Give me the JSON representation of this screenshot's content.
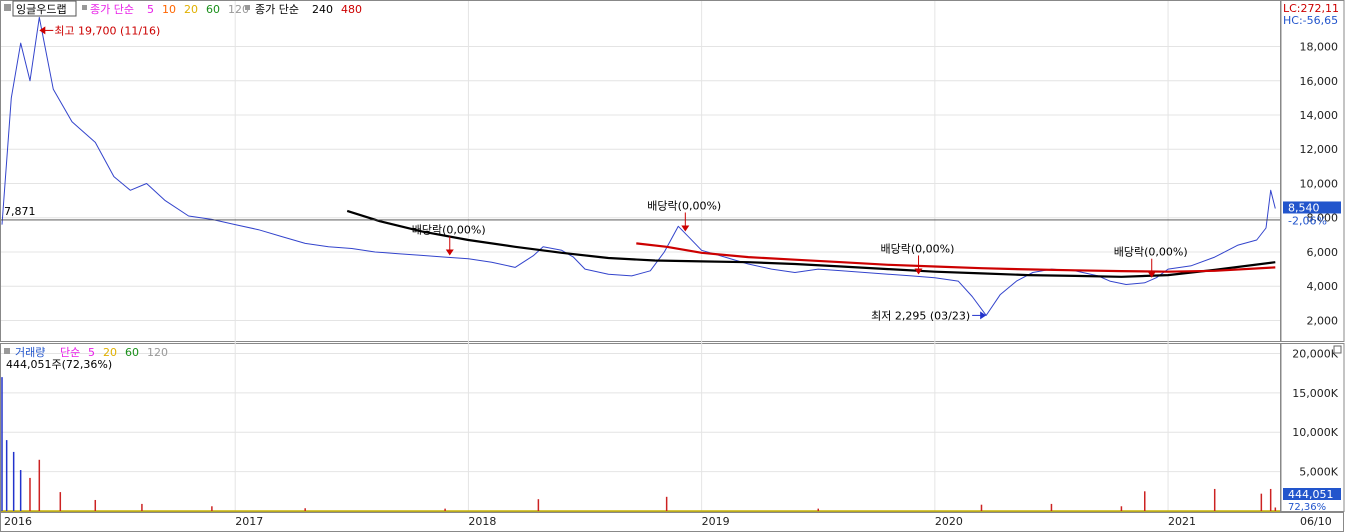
{
  "price_legend": {
    "title": "잉글우드랩",
    "ma_label": "종가 단순",
    "ma_periods": [
      "5",
      "10",
      "20",
      "60",
      "120"
    ],
    "ma_colors": [
      "#e81ee8",
      "#ff6600",
      "#e0b000",
      "#1a8f1a",
      "#999999"
    ],
    "ma2_label": "종가 단순",
    "ma2_periods": [
      "240",
      "480"
    ],
    "ma2_colors": [
      "#000000",
      "#cc0000"
    ]
  },
  "volume_legend": {
    "title": "거래량",
    "ma_label": "단순",
    "ma_periods": [
      "5",
      "20",
      "60",
      "120"
    ],
    "ma_colors": [
      "#e81ee8",
      "#e0b000",
      "#1a8f1a",
      "#999999"
    ],
    "current_value": "444,051주(72,36%)"
  },
  "info": {
    "lc": "LC:272,11",
    "hc": "HC:-56,65"
  },
  "labels": {
    "high": "최고 19,700 (11/16)",
    "low": "최저 2,295 (03/23)",
    "left_price": "7,871",
    "current_price": "8,540",
    "current_change": "-2,06%",
    "current_volume": "444,051",
    "current_volume_pct": "72,36%"
  },
  "annotations": [
    {
      "text": "배당락(0,00%)",
      "year": 2017.92
    },
    {
      "text": "배당락(0,00%)",
      "year": 2018.93
    },
    {
      "text": "배당락(0,00%)",
      "year": 2019.93
    },
    {
      "text": "배당락(0,00%)",
      "year": 2020.93
    }
  ],
  "chart_data": {
    "type": "line",
    "x_tick_labels": [
      "2016",
      "2017",
      "2018",
      "2019",
      "2020",
      "2021",
      "06/10"
    ],
    "y_ticks": [
      "2,000",
      "4,000",
      "6,000",
      "8,000",
      "10,000",
      "12,000",
      "14,000",
      "16,000",
      "18,000"
    ],
    "y_range": [
      800,
      20600
    ],
    "volume_ticks": [
      "5,000K",
      "10,000K",
      "15,000K",
      "20,000K"
    ],
    "volume_range": [
      0,
      21200
    ],
    "horizontal_reference_line": 7871,
    "series": [
      {
        "name": "종가",
        "color": "#3344cc",
        "points": [
          [
            2016.0,
            7600
          ],
          [
            2016.04,
            15000
          ],
          [
            2016.08,
            18200
          ],
          [
            2016.12,
            16000
          ],
          [
            2016.16,
            19700
          ],
          [
            2016.22,
            15500
          ],
          [
            2016.3,
            13600
          ],
          [
            2016.4,
            12400
          ],
          [
            2016.48,
            10400
          ],
          [
            2016.55,
            9600
          ],
          [
            2016.62,
            10000
          ],
          [
            2016.7,
            9000
          ],
          [
            2016.8,
            8100
          ],
          [
            2016.9,
            7900
          ],
          [
            2017.0,
            7600
          ],
          [
            2017.1,
            7300
          ],
          [
            2017.2,
            6900
          ],
          [
            2017.3,
            6500
          ],
          [
            2017.4,
            6300
          ],
          [
            2017.5,
            6200
          ],
          [
            2017.6,
            6000
          ],
          [
            2017.7,
            5900
          ],
          [
            2017.8,
            5800
          ],
          [
            2017.9,
            5700
          ],
          [
            2018.0,
            5600
          ],
          [
            2018.1,
            5400
          ],
          [
            2018.2,
            5100
          ],
          [
            2018.28,
            5800
          ],
          [
            2018.32,
            6300
          ],
          [
            2018.4,
            6100
          ],
          [
            2018.45,
            5700
          ],
          [
            2018.5,
            5000
          ],
          [
            2018.6,
            4700
          ],
          [
            2018.7,
            4600
          ],
          [
            2018.78,
            4900
          ],
          [
            2018.84,
            6000
          ],
          [
            2018.9,
            7500
          ],
          [
            2018.95,
            6800
          ],
          [
            2019.0,
            6100
          ],
          [
            2019.1,
            5700
          ],
          [
            2019.2,
            5300
          ],
          [
            2019.3,
            5000
          ],
          [
            2019.4,
            4800
          ],
          [
            2019.5,
            5000
          ],
          [
            2019.6,
            4900
          ],
          [
            2019.7,
            4800
          ],
          [
            2019.8,
            4700
          ],
          [
            2019.9,
            4600
          ],
          [
            2020.0,
            4500
          ],
          [
            2020.1,
            4300
          ],
          [
            2020.16,
            3400
          ],
          [
            2020.22,
            2295
          ],
          [
            2020.28,
            3500
          ],
          [
            2020.35,
            4300
          ],
          [
            2020.42,
            4800
          ],
          [
            2020.5,
            5000
          ],
          [
            2020.6,
            4900
          ],
          [
            2020.7,
            4600
          ],
          [
            2020.75,
            4300
          ],
          [
            2020.82,
            4100
          ],
          [
            2020.9,
            4200
          ],
          [
            2020.95,
            4500
          ],
          [
            2021.0,
            5000
          ],
          [
            2021.1,
            5200
          ],
          [
            2021.2,
            5700
          ],
          [
            2021.3,
            6400
          ],
          [
            2021.38,
            6700
          ],
          [
            2021.42,
            7400
          ],
          [
            2021.44,
            9600
          ],
          [
            2021.46,
            8540
          ]
        ]
      },
      {
        "name": "240",
        "color": "#000000",
        "points": [
          [
            2017.48,
            8400
          ],
          [
            2017.62,
            7800
          ],
          [
            2017.8,
            7200
          ],
          [
            2018.0,
            6700
          ],
          [
            2018.2,
            6300
          ],
          [
            2018.4,
            5950
          ],
          [
            2018.6,
            5650
          ],
          [
            2018.8,
            5500
          ],
          [
            2019.0,
            5450
          ],
          [
            2019.2,
            5400
          ],
          [
            2019.4,
            5300
          ],
          [
            2019.6,
            5150
          ],
          [
            2019.8,
            5000
          ],
          [
            2020.0,
            4850
          ],
          [
            2020.2,
            4750
          ],
          [
            2020.4,
            4650
          ],
          [
            2020.6,
            4600
          ],
          [
            2020.8,
            4550
          ],
          [
            2021.0,
            4650
          ],
          [
            2021.2,
            4950
          ],
          [
            2021.46,
            5400
          ]
        ]
      },
      {
        "name": "480",
        "color": "#cc0000",
        "points": [
          [
            2018.72,
            6500
          ],
          [
            2018.85,
            6300
          ],
          [
            2019.0,
            5950
          ],
          [
            2019.2,
            5700
          ],
          [
            2019.4,
            5550
          ],
          [
            2019.6,
            5400
          ],
          [
            2019.8,
            5250
          ],
          [
            2020.0,
            5150
          ],
          [
            2020.2,
            5050
          ],
          [
            2020.4,
            4980
          ],
          [
            2020.6,
            4930
          ],
          [
            2020.8,
            4880
          ],
          [
            2021.0,
            4850
          ],
          [
            2021.2,
            4900
          ],
          [
            2021.46,
            5100
          ]
        ]
      }
    ],
    "volume_spikes": [
      [
        2016.0,
        17000
      ],
      [
        2016.02,
        9000
      ],
      [
        2016.05,
        7500
      ],
      [
        2016.08,
        5200
      ],
      [
        2016.12,
        4200
      ],
      [
        2016.16,
        6500
      ],
      [
        2016.25,
        2400
      ],
      [
        2016.4,
        1400
      ],
      [
        2016.6,
        900
      ],
      [
        2016.9,
        600
      ],
      [
        2017.3,
        350
      ],
      [
        2017.9,
        300
      ],
      [
        2018.3,
        1500
      ],
      [
        2018.85,
        1800
      ],
      [
        2019.5,
        300
      ],
      [
        2020.2,
        800
      ],
      [
        2020.5,
        900
      ],
      [
        2020.8,
        600
      ],
      [
        2020.9,
        2500
      ],
      [
        2021.2,
        2800
      ],
      [
        2021.4,
        2200
      ],
      [
        2021.44,
        2800
      ],
      [
        2021.46,
        444
      ]
    ]
  }
}
